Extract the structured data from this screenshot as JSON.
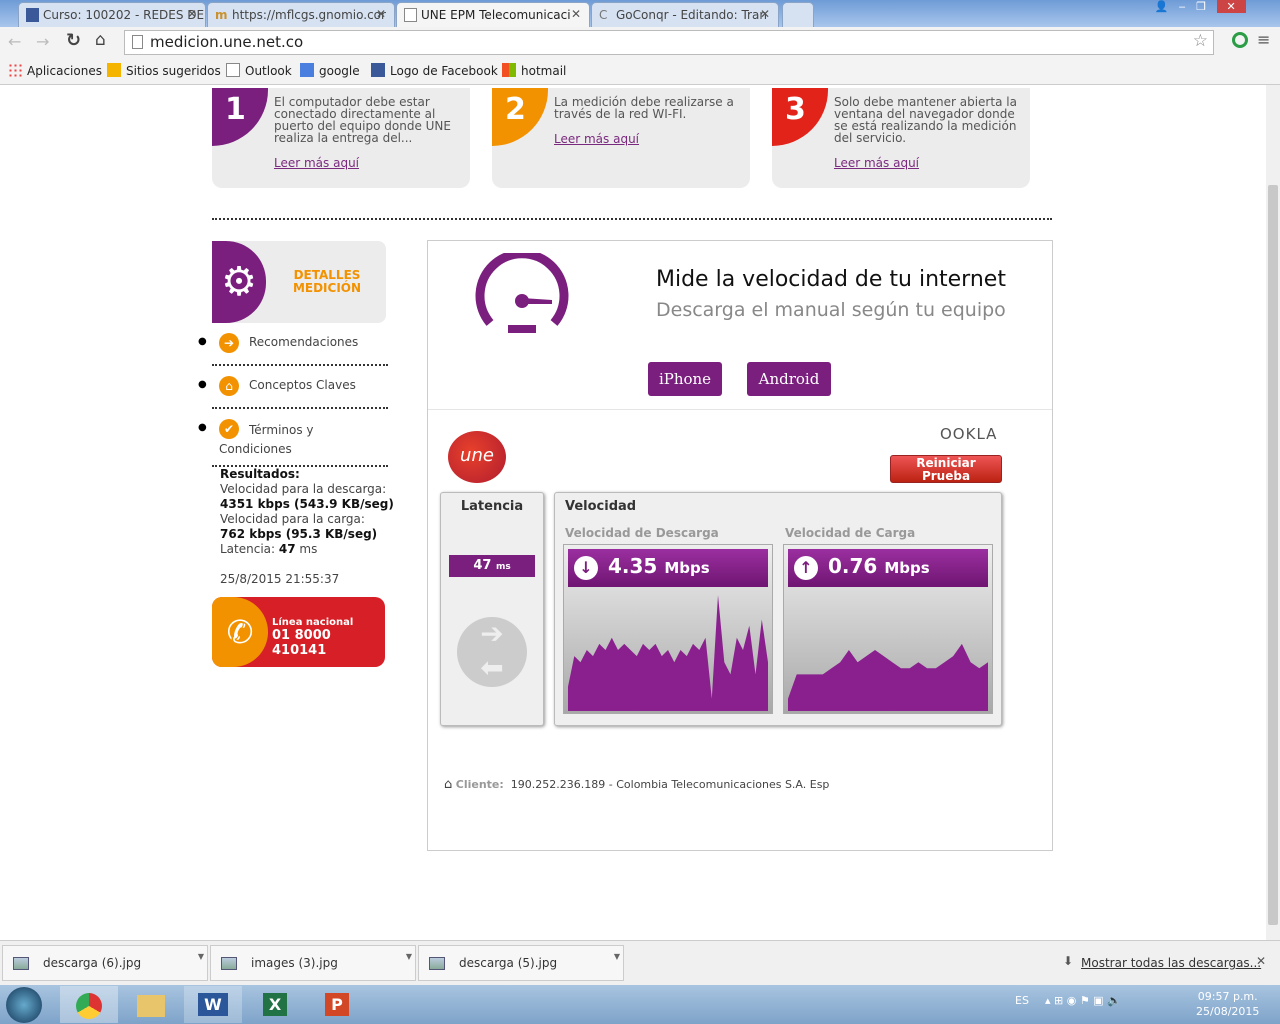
{
  "browser": {
    "tabs": [
      {
        "label": "Curso: 100202 - REDES DE"
      },
      {
        "label": "https://mflcgs.gnomio.cor"
      },
      {
        "label": "UNE EPM Telecomunicaci"
      },
      {
        "label": "GoConqr - Editando: Tran"
      }
    ],
    "url": "medicion.une.net.co",
    "bookmarks": [
      "Aplicaciones",
      "Sitios sugeridos",
      "Outlook",
      "google",
      "Logo de Facebook",
      "hotmail"
    ]
  },
  "steps": [
    {
      "num": "1",
      "text": "El computador debe estar conectado directamente al puerto del equipo donde UNE realiza la entrega del...",
      "link": "Leer más aquí",
      "color": "#7b1f7f"
    },
    {
      "num": "2",
      "text": "La medición debe realizarse a través de la red WI-FI.",
      "link": "Leer más aquí",
      "color": "#f39200"
    },
    {
      "num": "3",
      "text": "Solo debe mantener abierta la ventana del navegador donde se está realizando la medición del servicio.",
      "link": "Leer más aquí",
      "color": "#e2231a"
    }
  ],
  "sidebar": {
    "details_title": "DETALLES MEDICIÓN",
    "items": [
      "Recomendaciones",
      "Conceptos Claves",
      "Términos y Condiciones"
    ],
    "results": {
      "title": "Resultados:",
      "download_label": "Velocidad para la descarga:",
      "download_value": "4351 kbps (543.9 KB/seg)",
      "upload_label": "Velocidad para la carga:",
      "upload_value": "762 kbps (95.3 KB/seg)",
      "latency_label": "Latencia:",
      "latency_value": "47",
      "latency_unit": "ms",
      "datetime": "25/8/2015 21:55:37"
    },
    "hotline": {
      "label": "Línea nacional",
      "number": "01 8000 410141"
    }
  },
  "main": {
    "title": "Mide la velocidad de tu internet",
    "subtitle": "Descarga el manual según tu equipo",
    "iphone": "iPhone",
    "android": "Android",
    "ookla": "OOKLA",
    "restart": "Reiniciar Prueba",
    "logo": "une",
    "latency_title": "Latencia",
    "latency_value": "47",
    "latency_unit": "ms",
    "speed_title": "Velocidad",
    "download_title": "Velocidad de Descarga",
    "download_value": "4.35",
    "upload_title": "Velocidad de Carga",
    "upload_value": "0.76",
    "unit": "Mbps",
    "download_samples": [
      0.2,
      0.45,
      0.4,
      0.5,
      0.45,
      0.55,
      0.5,
      0.6,
      0.5,
      0.55,
      0.5,
      0.45,
      0.55,
      0.5,
      0.55,
      0.45,
      0.5,
      0.4,
      0.5,
      0.45,
      0.55,
      0.5,
      0.6,
      0.1,
      0.95,
      0.4,
      0.3,
      0.6,
      0.5,
      0.7,
      0.3,
      0.75,
      0.4
    ],
    "upload_samples": [
      0.1,
      0.3,
      0.3,
      0.3,
      0.3,
      0.35,
      0.4,
      0.5,
      0.4,
      0.45,
      0.5,
      0.45,
      0.4,
      0.35,
      0.35,
      0.4,
      0.35,
      0.35,
      0.4,
      0.45,
      0.55,
      0.4,
      0.35,
      0.4
    ],
    "client_label": "Cliente:",
    "client_value": "190.252.236.189 - Colombia Telecomunicaciones S.A. Esp"
  },
  "downloads": {
    "items": [
      "descarga (6).jpg",
      "images (3).jpg",
      "descarga (5).jpg"
    ],
    "show_all": "Mostrar todas las descargas..."
  },
  "taskbar": {
    "lang": "ES",
    "time": "09:57 p.m.",
    "date": "25/08/2015"
  }
}
